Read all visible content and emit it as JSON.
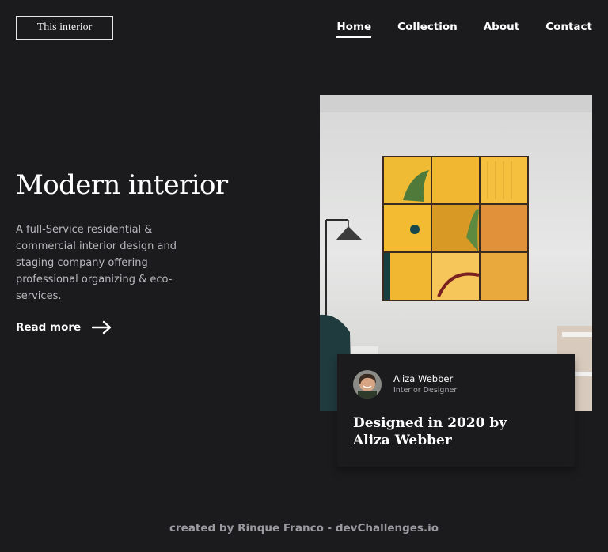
{
  "brand": {
    "logo_text": "This interior"
  },
  "nav": {
    "items": [
      {
        "label": "Home",
        "active": true
      },
      {
        "label": "Collection",
        "active": false
      },
      {
        "label": "About",
        "active": false
      },
      {
        "label": "Contact",
        "active": false
      }
    ]
  },
  "hero": {
    "title": "Modern interior",
    "description": "A full-Service residential & commercial interior design and staging company offering professional organizing & eco-services.",
    "cta_label": "Read more",
    "cta_icon": "arrow-right-icon"
  },
  "feature": {
    "image_icon": "interior-photo",
    "designer_name": "Aliza Webber",
    "designer_role": "Interior Designer",
    "caption": "Designed in 2020 by Aliza Webber"
  },
  "footer": {
    "text": "created by Rinque Franco - devChallenges.io"
  },
  "colors": {
    "background": "#1b1b1d",
    "text": "#ffffff",
    "muted": "#b9b9bd",
    "accent_yellow": "#f2b72e"
  }
}
